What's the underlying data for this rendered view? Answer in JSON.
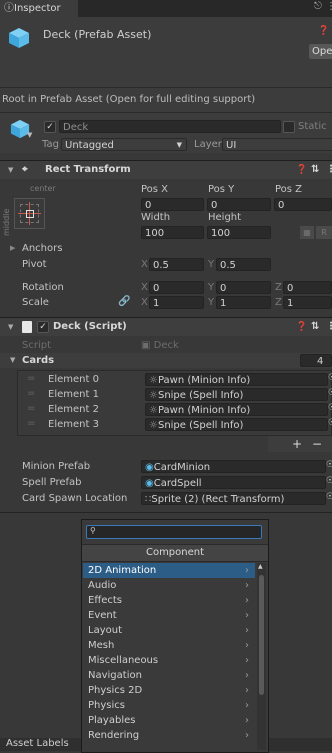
{
  "tab": {
    "title": "Inspector"
  },
  "asset": {
    "title": "Deck (Prefab Asset)",
    "open_label": "Open"
  },
  "notice": "Root in Prefab Asset (Open for full editing support)",
  "go": {
    "name": "Deck",
    "static_label": "Static",
    "tag_label": "Tag",
    "tag_value": "Untagged",
    "layer_label": "Layer",
    "layer_value": "UI"
  },
  "rect": {
    "title": "Rect Transform",
    "anchor_h": "center",
    "anchor_v": "middle",
    "pos_x_label": "Pos X",
    "pos_y_label": "Pos Y",
    "pos_z_label": "Pos Z",
    "pos_x": "0",
    "pos_y": "0",
    "pos_z": "0",
    "width_label": "Width",
    "height_label": "Height",
    "width": "100",
    "height": "100",
    "raw_btn": "R",
    "anchors_label": "Anchors",
    "pivot_label": "Pivot",
    "pivot_x": "0.5",
    "pivot_y": "0.5",
    "rotation_label": "Rotation",
    "rot_x": "0",
    "rot_y": "0",
    "rot_z": "0",
    "scale_label": "Scale",
    "scale_x": "1",
    "scale_y": "1",
    "scale_z": "1",
    "x": "X",
    "y": "Y",
    "z": "Z"
  },
  "deck": {
    "title": "Deck (Script)",
    "script_label": "Script",
    "script_value": "Deck",
    "cards_label": "Cards",
    "cards_count": "4",
    "elements": [
      {
        "label": "Element 0",
        "value": "Pawn (Minion Info)"
      },
      {
        "label": "Element 1",
        "value": "Snipe (Spell Info)"
      },
      {
        "label": "Element 2",
        "value": "Pawn (Minion Info)"
      },
      {
        "label": "Element 3",
        "value": "Snipe (Spell Info)"
      }
    ],
    "plus": "+",
    "minus": "−",
    "minion_label": "Minion Prefab",
    "minion_value": "CardMinion",
    "spell_label": "Spell Prefab",
    "spell_value": "CardSpell",
    "spawn_label": "Card Spawn Location",
    "spawn_value": "Sprite (2) (Rect Transform)"
  },
  "popup": {
    "search_value": "",
    "title": "Component",
    "items": [
      "2D Animation",
      "Audio",
      "Effects",
      "Event",
      "Layout",
      "Mesh",
      "Miscellaneous",
      "Navigation",
      "Physics 2D",
      "Physics",
      "Playables",
      "Rendering"
    ]
  },
  "footer": {
    "asset_labels": "Asset Labels"
  },
  "colors": {
    "selected": "#2c5d87",
    "bg": "#383838"
  }
}
